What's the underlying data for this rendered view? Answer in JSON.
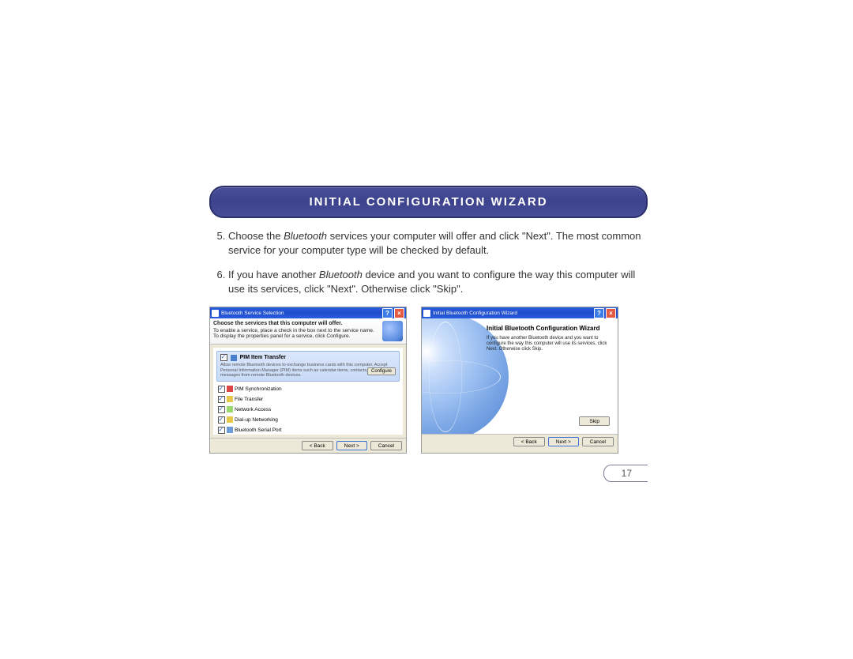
{
  "header": {
    "title": "INITIAL CONFIGURATION WIZARD"
  },
  "steps": {
    "start": 5,
    "s5a": "Choose the ",
    "s5em": "Bluetooth",
    "s5b": " services your computer will offer and click \"Next\". The most common service for your computer type will be checked by default.",
    "s6a": "If you have another ",
    "s6em": "Bluetooth",
    "s6b": " device and you want to configure the way this computer will use its services, click \"Next\". Otherwise click \"Skip\"."
  },
  "win1": {
    "title": "Bluetooth Service Selection",
    "banner_bold": "Choose the services that this computer will offer.",
    "banner_line1": "To enable a service, place a check in the box next to the service name.",
    "banner_line2": "To display the properties panel for a service, click Configure.",
    "hl_title": "PIM Item Transfer",
    "hl_desc": "Allow remote Bluetooth devices to exchange business cards with this computer. Accept Personal Information Manager (PIM) items such as calendar items, contacts, notes and messages from remote Bluetooth devices.",
    "configure": "Configure",
    "services": [
      "PIM Synchronization",
      "File Transfer",
      "Network Access",
      "Dial-up Networking",
      "Bluetooth Serial Port"
    ],
    "back": "< Back",
    "next": "Next >",
    "cancel": "Cancel"
  },
  "win2": {
    "title": "Initial Bluetooth Configuration Wizard",
    "heading": "Initial Bluetooth Configuration Wizard",
    "body": "If you have another Bluetooth device and you want to configure the way this computer will use its services, click Next. Otherwise click Skip.",
    "skip": "Skip",
    "back": "< Back",
    "next": "Next >",
    "cancel": "Cancel"
  },
  "page_number": "17"
}
